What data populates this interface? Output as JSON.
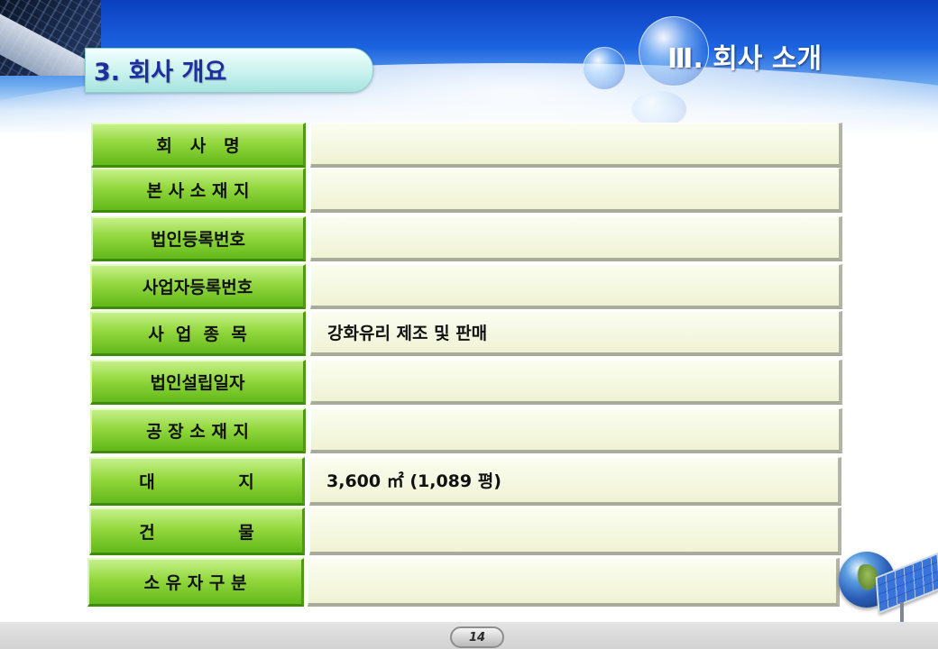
{
  "header": {
    "section_title": "Ⅲ. 회사 소개",
    "sub_title": "3. 회사 개요"
  },
  "table": {
    "rows": [
      {
        "label": "회   사   명",
        "value": ""
      },
      {
        "label": "본 사 소 재 지",
        "value": ""
      },
      {
        "label": "법인등록번호",
        "value": ""
      },
      {
        "label": "사업자등록번호",
        "value": ""
      },
      {
        "label": "사  업  종  목",
        "value": "강화유리 제조 및 판매"
      },
      {
        "label": "법인설립일자",
        "value": ""
      },
      {
        "label": "공 장 소 재 지",
        "value": ""
      },
      {
        "label": "대              지",
        "value": "3,600 ㎡ (1,089 평)"
      },
      {
        "label": "건              물",
        "value": ""
      },
      {
        "label": "소 유 자 구 분",
        "value": ""
      }
    ]
  },
  "footer": {
    "page_number": "14"
  },
  "decor": {
    "icons": [
      "solar-panel-icon",
      "globe-icon",
      "bubble-icon"
    ],
    "colors": {
      "header_blue": "#1c63e0",
      "label_green": "#93d83e",
      "value_cream": "#f3f6dc",
      "subtitle_text": "#1d2ea0"
    }
  }
}
